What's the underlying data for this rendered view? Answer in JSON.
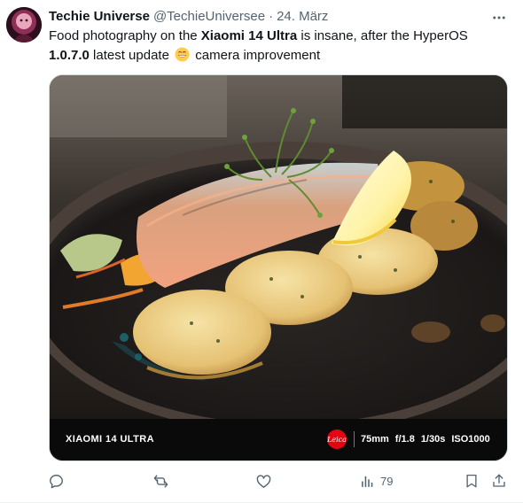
{
  "author": {
    "display_name": "Techie Universe",
    "handle": "@TechieUniversee",
    "separator": "·",
    "date": "24. März"
  },
  "tweet": {
    "text_1": "Food photography on the ",
    "bold_1": "Xiaomi 14 Ultra",
    "text_2": " is insane, after the HyperOS ",
    "bold_2": "1.0.7.0",
    "text_3": " latest update ",
    "text_4": " camera improvement"
  },
  "media": {
    "watermark": {
      "model": "XIAOMI 14 ULTRA",
      "focal_length": "75mm",
      "aperture": "f/1.8",
      "shutter": "1/30s",
      "iso": "ISO1000"
    }
  },
  "actions": {
    "views_count": "79"
  },
  "icons": {
    "more": "more-dots-icon",
    "reply": "reply-icon",
    "retweet": "retweet-icon",
    "like": "heart-icon",
    "views": "views-bar-chart-icon",
    "bookmark": "bookmark-icon",
    "share": "share-icon",
    "emoji": "grinning-face-icon",
    "leica": "leica-logo-icon"
  },
  "colors": {
    "text_primary": "#0f1419",
    "text_secondary": "#536471",
    "border": "#cfd9de",
    "leica_red": "#e20612"
  }
}
